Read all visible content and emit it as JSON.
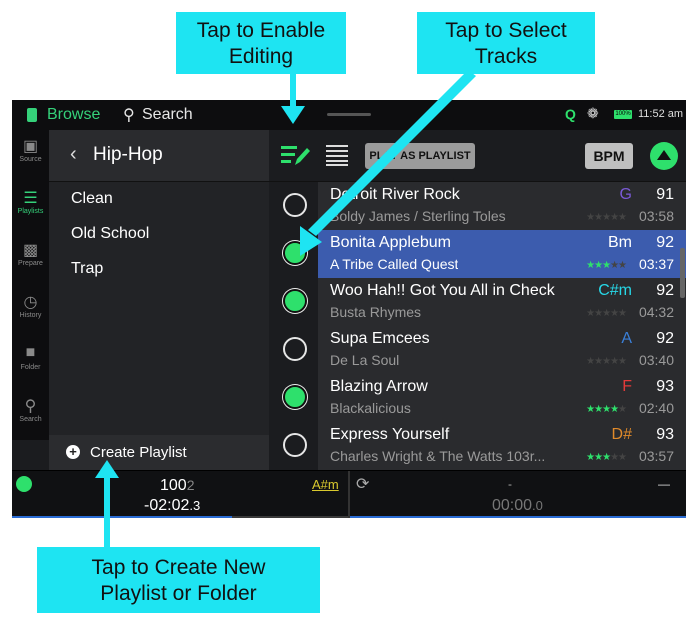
{
  "callouts": {
    "edit": [
      "Tap to Enable",
      "Editing"
    ],
    "select": [
      "Tap to Select",
      "Tracks"
    ],
    "create": [
      "Tap to Create New",
      "Playlist or Folder"
    ]
  },
  "topbar": {
    "browse_label": "Browse",
    "search_label": "Search",
    "battery": "100%",
    "clock": "11:52 am"
  },
  "rail": [
    {
      "icon": "source-icon",
      "label": "Source"
    },
    {
      "icon": "playlists-icon",
      "label": "Playlists"
    },
    {
      "icon": "prepare-icon",
      "label": "Prepare"
    },
    {
      "icon": "history-icon",
      "label": "History"
    },
    {
      "icon": "folder-icon",
      "label": "Folder"
    },
    {
      "icon": "search-icon",
      "label": "Search"
    }
  ],
  "playlist_pane": {
    "title": "Hip-Hop",
    "items": [
      "Clean",
      "Old School",
      "Trap"
    ],
    "create_label": "Create Playlist"
  },
  "track_header": {
    "play_as_label": "PLAY AS PLAYLIST",
    "bpm_label": "BPM"
  },
  "tracks": [
    {
      "title": "Detroit River Rock",
      "artist": "Boldy James / Sterling Toles",
      "key": "G",
      "key_color": "#7a5ad6",
      "bpm": "91",
      "stars": "★★★★★",
      "rating": 0,
      "duration": "03:58",
      "checked": false,
      "selected": false
    },
    {
      "title": "Bonita Applebum",
      "artist": "A Tribe Called Quest",
      "key": "Bm",
      "key_color": "#ffffff",
      "bpm": "92",
      "stars": "★★★★★",
      "rating": 3,
      "duration": "03:37",
      "checked": true,
      "selected": true
    },
    {
      "title": "Woo Hah!! Got You All in Check",
      "artist": "Busta Rhymes",
      "key": "C#m",
      "key_color": "#27d8e8",
      "bpm": "92",
      "stars": "★★★★★",
      "rating": 0,
      "duration": "04:32",
      "checked": true,
      "selected": false
    },
    {
      "title": "Supa Emcees",
      "artist": "De La Soul",
      "key": "A",
      "key_color": "#3a7fd8",
      "bpm": "92",
      "stars": "★★★★★",
      "rating": 0,
      "duration": "03:40",
      "checked": false,
      "selected": false
    },
    {
      "title": "Blazing Arrow",
      "artist": "Blackalicious",
      "key": "F",
      "key_color": "#e23a3a",
      "bpm": "93",
      "stars": "★★★★★",
      "rating": 4,
      "duration": "02:40",
      "checked": true,
      "selected": false
    },
    {
      "title": "Express Yourself",
      "artist": "Charles Wright & The Watts 103r...",
      "key": "D#",
      "key_color": "#e08a2a",
      "bpm": "93",
      "stars": "★★★★★",
      "rating": 3,
      "duration": "03:57",
      "checked": false,
      "selected": false
    }
  ],
  "deck1": {
    "bpm_main": "100",
    "bpm_frac": "2",
    "time_main": "-02:02",
    "time_frac": ".3",
    "key": "A#m",
    "progress": 0.65
  },
  "deck2": {
    "bpm": "-",
    "time_main": "00:00",
    "time_frac": ".0",
    "key": "—"
  },
  "colors": {
    "accent": "#2ee06c",
    "callout": "#1ee4f2",
    "selected_row": "#3c5cae"
  }
}
